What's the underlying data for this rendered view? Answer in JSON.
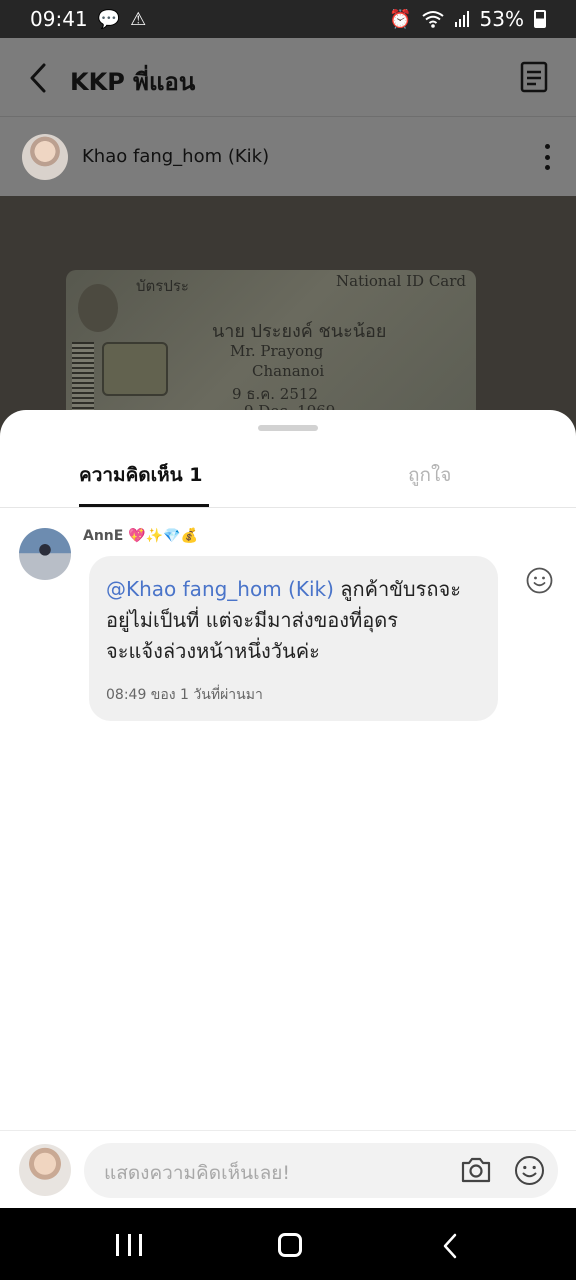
{
  "status_bar": {
    "time": "09:41",
    "battery": "53%",
    "left_icons": [
      "chat-bubble-icon",
      "warning-icon"
    ],
    "right_icons": [
      "alarm-icon",
      "wifi-icon",
      "signal-icon",
      "battery-icon"
    ]
  },
  "header": {
    "title": "KKP พี่แอน",
    "author": "Khao fang_hom (Kik)"
  },
  "id_card": {
    "lines": [
      "บัตรประ",
      "National ID Card",
      "นาย ประยงค์  ชนะน้อย",
      "Mr. Prayong",
      "Chananoi",
      "9 ธ.ค. 2512",
      "9 Dec. 1969"
    ]
  },
  "tabs": {
    "comments": "ความคิดเห็น 1",
    "likes": "ถูกใจ"
  },
  "comment": {
    "author": "AnnE 💖✨💎💰",
    "mention": "@Khao fang_hom (Kik)",
    "text_line1": " ลูกค้าขับรถจะ",
    "text_line2": "อยู่ไม่เป็นที่  แต่จะมีมาส่งของที่อุดร",
    "text_line3": "จะแจ้งล่วงหน้าหนึ่งวันค่ะ",
    "meta": "08:49 ของ 1 วันที่ผ่านมา"
  },
  "input": {
    "placeholder": "แสดงความคิดเห็นเลย!"
  },
  "colors": {
    "mention": "#4a74c9",
    "dim_overlay": "#7c7c7c",
    "sheet": "#ffffff"
  }
}
